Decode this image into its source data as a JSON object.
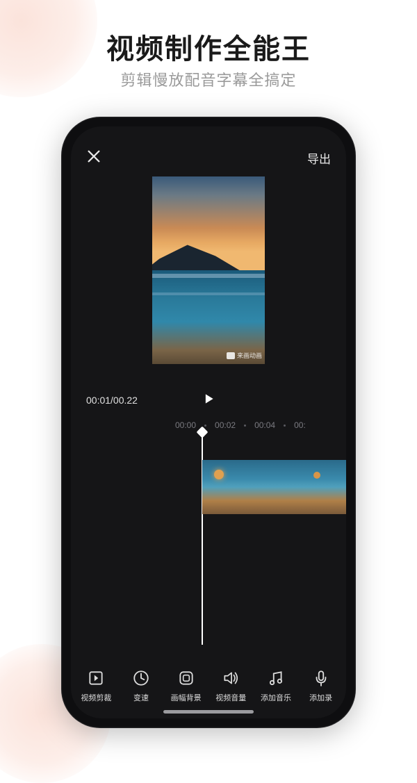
{
  "promo": {
    "title": "视频制作全能王",
    "subtitle": "剪辑慢放配音字幕全搞定"
  },
  "editor": {
    "export_label": "导出",
    "timecode": "00:01/00.22",
    "watermark_text": "来画动画",
    "ruler": [
      "00:00",
      "00:02",
      "00:04",
      "00:"
    ]
  },
  "tools": [
    {
      "icon": "crop",
      "label": "视频剪裁"
    },
    {
      "icon": "speed",
      "label": "变速"
    },
    {
      "icon": "frame",
      "label": "画幅背景"
    },
    {
      "icon": "volume",
      "label": "视频音量"
    },
    {
      "icon": "music",
      "label": "添加音乐"
    },
    {
      "icon": "mic",
      "label": "添加录"
    }
  ]
}
